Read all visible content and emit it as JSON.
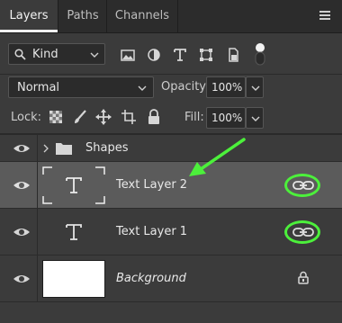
{
  "tabs": [
    {
      "label": "Layers",
      "active": true
    },
    {
      "label": "Paths",
      "active": false
    },
    {
      "label": "Channels",
      "active": false
    }
  ],
  "filter": {
    "kind_label": "Kind",
    "icons": [
      "image-filter-icon",
      "adjustment-filter-icon",
      "type-filter-icon",
      "shape-filter-icon",
      "smart-object-filter-icon",
      "filter-toggle-icon"
    ]
  },
  "blend": {
    "mode": "Normal",
    "opacity_label": "Opacity:",
    "opacity_value": "100%"
  },
  "lock": {
    "label": "Lock:",
    "fill_label": "Fill:",
    "fill_value": "100%",
    "icons": [
      "lock-transparent-icon",
      "lock-image-icon",
      "lock-position-icon",
      "lock-artboard-icon",
      "lock-all-icon"
    ]
  },
  "layers": [
    {
      "name": "Shapes",
      "type": "group",
      "visible": true
    },
    {
      "name": "Text Layer 2",
      "type": "text",
      "selected": true,
      "linked": true,
      "visible": true
    },
    {
      "name": "Text Layer 1",
      "type": "text",
      "selected": false,
      "linked": true,
      "visible": true
    },
    {
      "name": "Background",
      "type": "background",
      "locked": true,
      "visible": true
    }
  ],
  "annotation": {
    "color": "#4cf03b"
  }
}
